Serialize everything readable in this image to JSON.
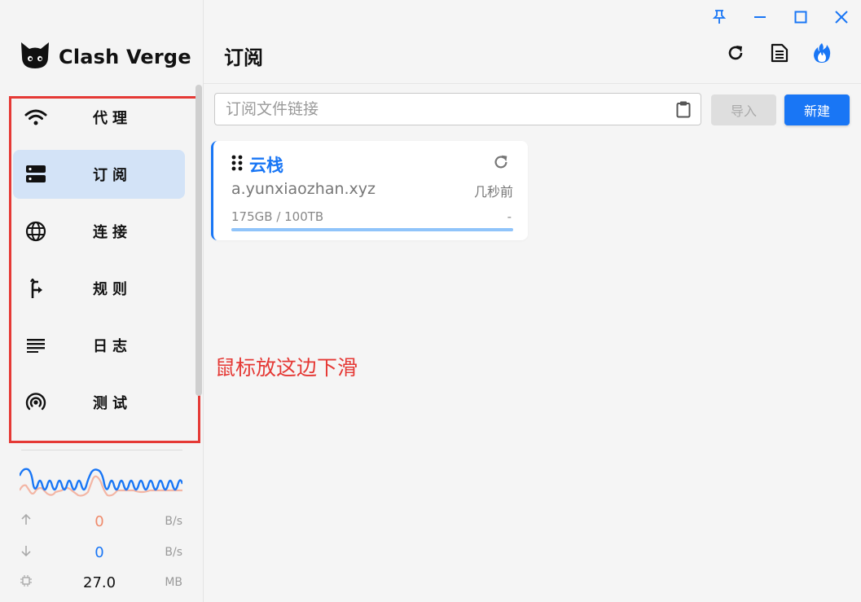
{
  "app": {
    "name": "Clash Verge"
  },
  "sidebar": {
    "items": [
      {
        "label": "代理",
        "icon": "wifi-icon",
        "active": false
      },
      {
        "label": "订阅",
        "icon": "server-icon",
        "active": true
      },
      {
        "label": "连接",
        "icon": "globe-icon",
        "active": false
      },
      {
        "label": "规则",
        "icon": "fork-arrow-icon",
        "active": false
      },
      {
        "label": "日志",
        "icon": "lines-icon",
        "active": false
      },
      {
        "label": "测试",
        "icon": "radar-icon",
        "active": false
      }
    ]
  },
  "stats": {
    "upload": {
      "value": "0",
      "unit": "B/s",
      "color": "#ef8a6b"
    },
    "download": {
      "value": "0",
      "unit": "B/s",
      "color": "#1976f5"
    },
    "memory": {
      "value": "27.0",
      "unit": "MB"
    }
  },
  "page": {
    "title": "订阅"
  },
  "subscription_input": {
    "placeholder": "订阅文件链接",
    "value": ""
  },
  "buttons": {
    "import_label": "导入",
    "new_label": "新建"
  },
  "profile_card": {
    "name": "云栈",
    "host": "a.yunxiaozhan.xyz",
    "updated": "几秒前",
    "usage": "175GB / 100TB",
    "expire": "-",
    "usage_fraction": 1.0
  },
  "annotation": {
    "text": "鼠标放这边下滑",
    "color": "#e53935"
  },
  "colors": {
    "accent": "#1976f5",
    "active_bg": "#d3e3f7",
    "annotation": "#e53935"
  }
}
